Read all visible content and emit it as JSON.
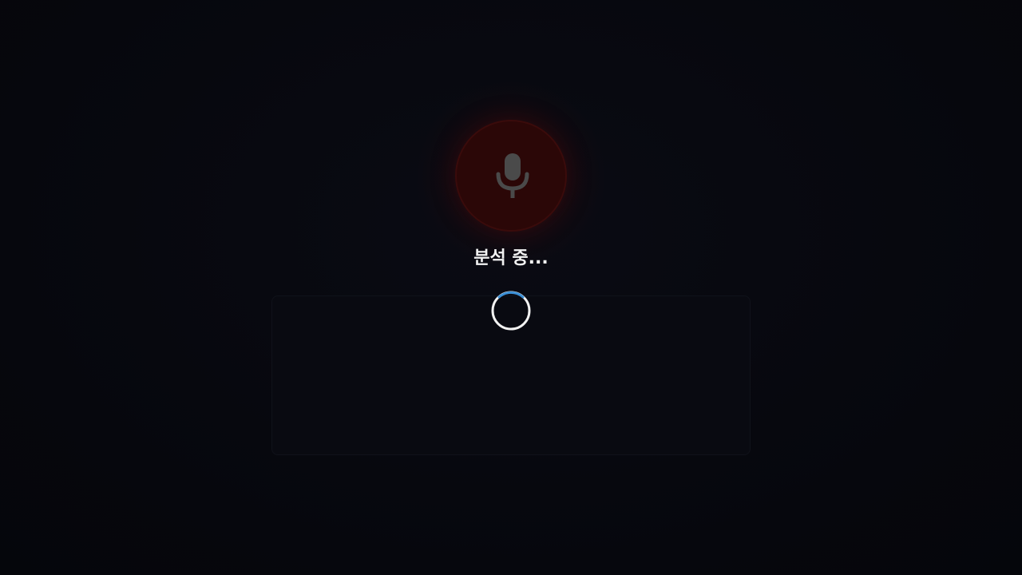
{
  "status": {
    "text": "분석 중..."
  },
  "mic": {
    "icon": "microphone-icon",
    "state": "analyzing",
    "color": "#2b0707"
  },
  "spinner": {
    "icon": "loading-spinner-icon",
    "accent": "#3a8fd6"
  },
  "transcript": {
    "text": ""
  }
}
